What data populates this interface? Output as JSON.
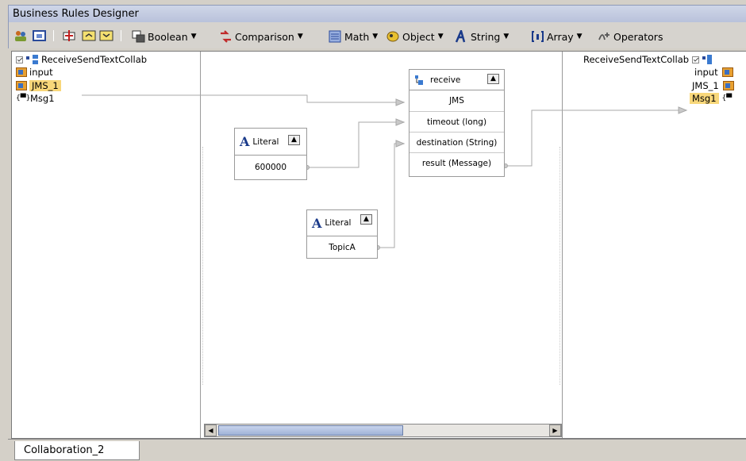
{
  "window": {
    "title": "Business Rules Designer"
  },
  "toolbar": {
    "icons": [
      "users-icon",
      "window-icon",
      "add-row-icon",
      "collapse-box-icon",
      "expand-box-icon"
    ],
    "menus": [
      {
        "label": "Boolean",
        "icon": "boolean-icon"
      },
      {
        "label": "Comparison",
        "icon": "comparison-icon"
      },
      {
        "label": "Math",
        "icon": "math-icon"
      },
      {
        "label": "Object",
        "icon": "object-icon"
      },
      {
        "label": "String",
        "icon": "string-icon"
      },
      {
        "label": "Array",
        "icon": "array-icon"
      },
      {
        "label": "Operators",
        "icon": "operators-icon"
      }
    ]
  },
  "left_tree": {
    "root": "ReceiveSendTextCollab",
    "items": [
      {
        "label": "input",
        "icon": "node-icon",
        "highlighted": false
      },
      {
        "label": "JMS_1",
        "icon": "node-icon",
        "highlighted": true
      },
      {
        "label": "Msg1",
        "icon": "message-icon",
        "highlighted": false
      }
    ]
  },
  "right_tree": {
    "root": "ReceiveSendTextCollab",
    "items": [
      {
        "label": "input",
        "highlighted": false
      },
      {
        "label": "JMS_1",
        "highlighted": false
      },
      {
        "label": "Msg1",
        "highlighted": true
      }
    ]
  },
  "receive_box": {
    "title": "receive",
    "ports": [
      "JMS",
      "timeout (long)",
      "destination (String)",
      "result (Message)"
    ]
  },
  "literal_1": {
    "title": "Literal",
    "value": "600000"
  },
  "literal_2": {
    "title": "Literal",
    "value": "TopicA"
  },
  "status": {
    "tab": "Collaboration_2"
  },
  "colors": {
    "highlight": "#f8d77a",
    "titlebar": "#b9c2db",
    "link": "#999999"
  }
}
